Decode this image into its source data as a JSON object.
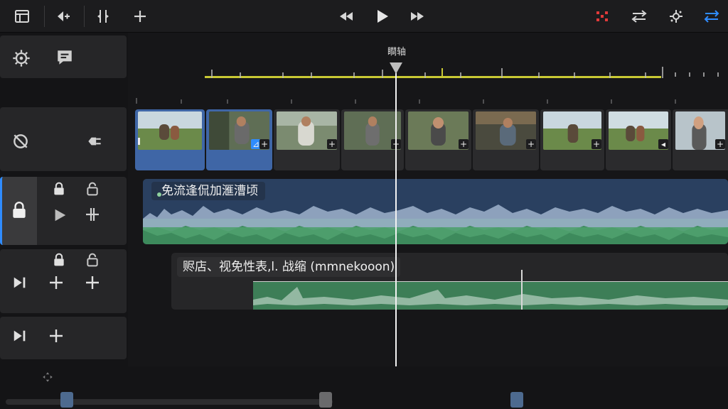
{
  "toolbar": {
    "left_icons": [
      "library-icon",
      "undo-icon",
      "split-icon",
      "add-icon"
    ],
    "center_icons": [
      "rewind-icon",
      "play-icon",
      "fast-forward-icon"
    ],
    "right_icons": [
      "record-icon",
      "swap-icon",
      "adjust-icon",
      "sort-icon"
    ],
    "accent_color": "#2f8cff",
    "record_color": "#e03a3a"
  },
  "timeline": {
    "ruler_label": "瞷轴",
    "ruler_color": "#c9c934"
  },
  "video_track": {
    "clip_count": 9,
    "selected_clip_color": "#3f66a6"
  },
  "audio_track_1": {
    "label": "免流逢侃加滙漕顷",
    "color": "#2a4060",
    "wave_color": "#3d8a5c"
  },
  "audio_track_2": {
    "label": "赆店、视免性表,l. 战缩 (mmnekooon)",
    "wave_color": "#3d7e57"
  },
  "left_panel": {
    "icons": [
      "settings-icon",
      "comment-icon",
      "rotate-icon",
      "plug-icon",
      "lock-icon",
      "small-lock-icon",
      "small-unlock-icon",
      "play-icon",
      "trim-icon",
      "skip-icon",
      "add-icon"
    ]
  }
}
